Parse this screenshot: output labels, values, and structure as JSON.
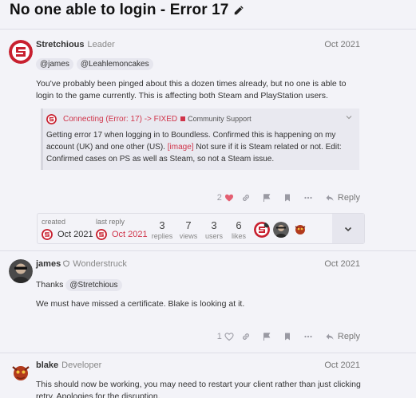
{
  "topic": {
    "title": "No one able to login - Error 17",
    "edit_icon": "pencil-icon"
  },
  "posts": [
    {
      "username": "Stretchious",
      "user_title": "Leader",
      "date": "Oct 2021",
      "mentions": [
        "@james",
        "@Leahlemoncakes"
      ],
      "text": "You've probably been pinged about this a dozen times already, but no one is able to login to the game currently. This is affecting both Steam and PlayStation users.",
      "quote": {
        "title": "Connecting (Error: 17) -> FIXED",
        "category": "Community Support",
        "category_color": "#d0344a",
        "body_before": "Getting error 17 when logging in to Boundless. Confirmed this is happening on my account (UK) and one other (US).",
        "image_link": "[image]",
        "body_after": "Not sure if it is Steam related or not. Edit: Confirmed cases on PS as well as Steam, so not a Steam issue."
      },
      "likes": "2",
      "reply_label": "Reply"
    },
    {
      "username": "james",
      "user_title": "Wonderstruck",
      "date": "Oct 2021",
      "thanks_prefix": "Thanks",
      "mention": "@Stretchious",
      "text": "We must have missed a certificate. Blake is looking at it.",
      "likes": "1",
      "reply_label": "Reply"
    },
    {
      "username": "blake",
      "user_title": "Developer",
      "date": "Oct 2021",
      "text": "This should now be working, you may need to restart your client rather than just clicking retry. Apologies for the disruption."
    }
  ],
  "topic_map": {
    "created_label": "created",
    "created_date": "Oct 2021",
    "last_reply_label": "last reply",
    "last_reply_date": "Oct 2021",
    "stats": [
      {
        "value": "3",
        "label": "replies"
      },
      {
        "value": "7",
        "label": "views"
      },
      {
        "value": "3",
        "label": "users"
      },
      {
        "value": "6",
        "label": "likes"
      }
    ]
  },
  "colors": {
    "accent": "#d0344a",
    "background": "#f3f3f8",
    "heart": "#e45f72"
  }
}
